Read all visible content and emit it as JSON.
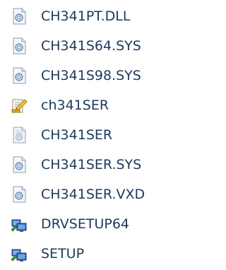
{
  "colors": {
    "text": "#1e395b",
    "background": "#ffffff"
  },
  "files": [
    {
      "name": "CH341PT.DLL",
      "icon": "system-file-icon"
    },
    {
      "name": "CH341S64.SYS",
      "icon": "system-file-icon"
    },
    {
      "name": "CH341S98.SYS",
      "icon": "system-file-icon"
    },
    {
      "name": "ch341SER",
      "icon": "setup-information-icon"
    },
    {
      "name": "CH341SER",
      "icon": "security-catalog-icon"
    },
    {
      "name": "CH341SER.SYS",
      "icon": "system-file-icon"
    },
    {
      "name": "CH341SER.VXD",
      "icon": "system-file-icon"
    },
    {
      "name": "DRVSETUP64",
      "icon": "installer-app-icon"
    },
    {
      "name": "SETUP",
      "icon": "installer-app-icon"
    }
  ]
}
